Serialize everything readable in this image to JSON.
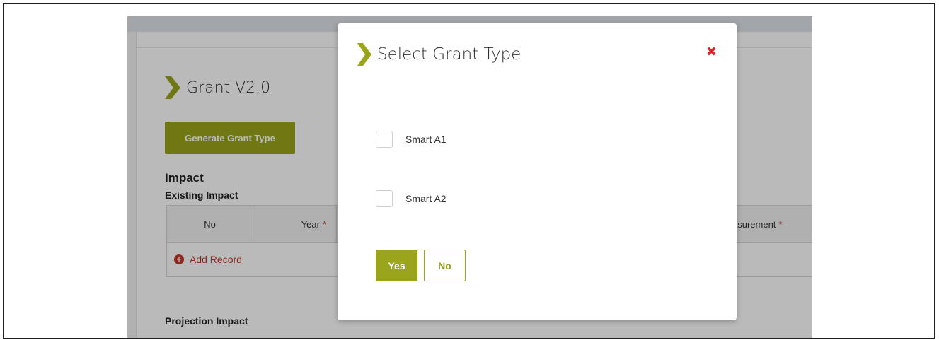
{
  "page": {
    "title": "Grant V2.0",
    "generate_button": "Generate Grant Type",
    "impact_heading": "Impact",
    "existing_impact_heading": "Existing Impact",
    "columns": [
      {
        "label": "No",
        "required": false
      },
      {
        "label": "Year",
        "required": true
      },
      {
        "label": "asurement",
        "required": true
      }
    ],
    "required_marker": "*",
    "add_record_label": "Add Record",
    "projection_impact_heading": "Projection Impact"
  },
  "modal": {
    "title": "Select Grant Type",
    "close_symbol": "✖",
    "options": [
      {
        "label": "Smart A1",
        "checked": false
      },
      {
        "label": "Smart A2",
        "checked": false
      }
    ],
    "yes_label": "Yes",
    "no_label": "No"
  },
  "colors": {
    "accent": "#9aa51c",
    "danger": "#d9262c"
  }
}
